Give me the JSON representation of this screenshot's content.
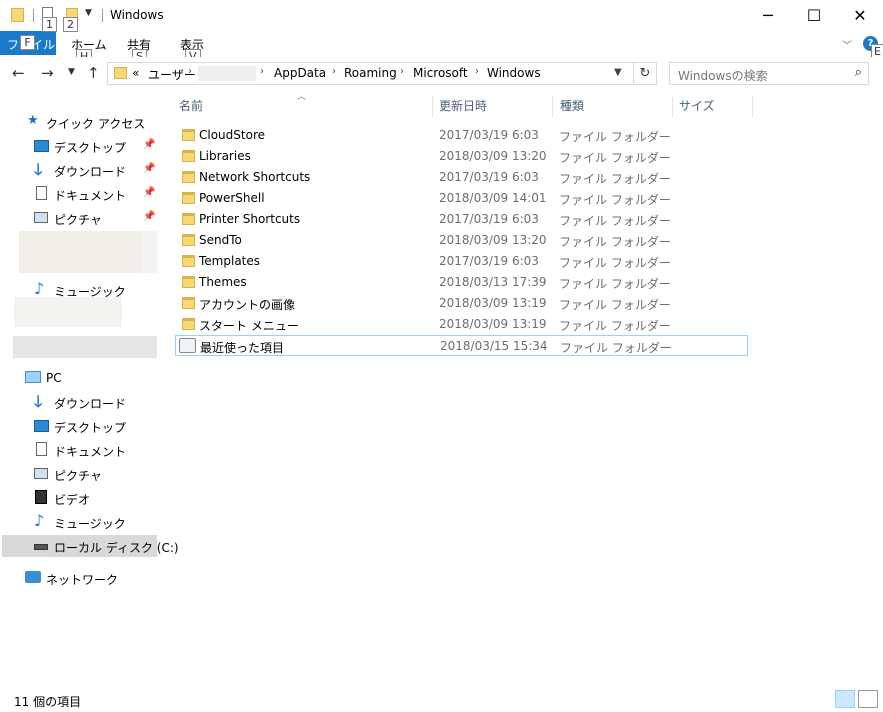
{
  "titlebar": {
    "title": "Windows",
    "keytips": [
      "1",
      "2"
    ],
    "minimize": "─",
    "maximize": "☐",
    "close": "✕"
  },
  "ribbon": {
    "file_tab": "ファイル",
    "file_keytip": "F",
    "tabs": [
      {
        "label": "ホーム",
        "keytip": "H"
      },
      {
        "label": "共有",
        "keytip": "S"
      },
      {
        "label": "表示",
        "keytip": "V"
      }
    ],
    "help_keytip": "E"
  },
  "address": {
    "overflow": "«",
    "crumbs": [
      "ユーザー",
      "AppData",
      "Roaming",
      "Microsoft",
      "Windows"
    ],
    "separator": "›"
  },
  "search": {
    "placeholder": "Windowsの検索"
  },
  "navpane": {
    "quick_access": "クイック アクセス",
    "quick_items": [
      "デスクトップ",
      "ダウンロード",
      "ドキュメント",
      "ピクチャ"
    ],
    "music_1": "ミュージック",
    "pc": "PC",
    "pc_items": [
      "ダウンロード",
      "デスクトップ",
      "ドキュメント",
      "ピクチャ",
      "ビデオ",
      "ミュージック",
      "ローカル ディスク (C:)"
    ],
    "network": "ネットワーク"
  },
  "columns": {
    "name": "名前",
    "date": "更新日時",
    "type": "種類",
    "size": "サイズ"
  },
  "files": [
    {
      "name": "CloudStore",
      "date": "2017/03/19 6:03",
      "type": "ファイル フォルダー"
    },
    {
      "name": "Libraries",
      "date": "2018/03/09 13:20",
      "type": "ファイル フォルダー"
    },
    {
      "name": "Network Shortcuts",
      "date": "2017/03/19 6:03",
      "type": "ファイル フォルダー"
    },
    {
      "name": "PowerShell",
      "date": "2018/03/09 14:01",
      "type": "ファイル フォルダー"
    },
    {
      "name": "Printer Shortcuts",
      "date": "2017/03/19 6:03",
      "type": "ファイル フォルダー"
    },
    {
      "name": "SendTo",
      "date": "2018/03/09 13:20",
      "type": "ファイル フォルダー"
    },
    {
      "name": "Templates",
      "date": "2017/03/19 6:03",
      "type": "ファイル フォルダー"
    },
    {
      "name": "Themes",
      "date": "2018/03/13 17:39",
      "type": "ファイル フォルダー"
    },
    {
      "name": "アカウントの画像",
      "date": "2018/03/09 13:19",
      "type": "ファイル フォルダー"
    },
    {
      "name": "スタート メニュー",
      "date": "2018/03/09 13:19",
      "type": "ファイル フォルダー"
    },
    {
      "name": "最近使った項目",
      "date": "2018/03/15 15:34",
      "type": "ファイル フォルダー"
    }
  ],
  "status": {
    "item_count": "11 個の項目"
  }
}
